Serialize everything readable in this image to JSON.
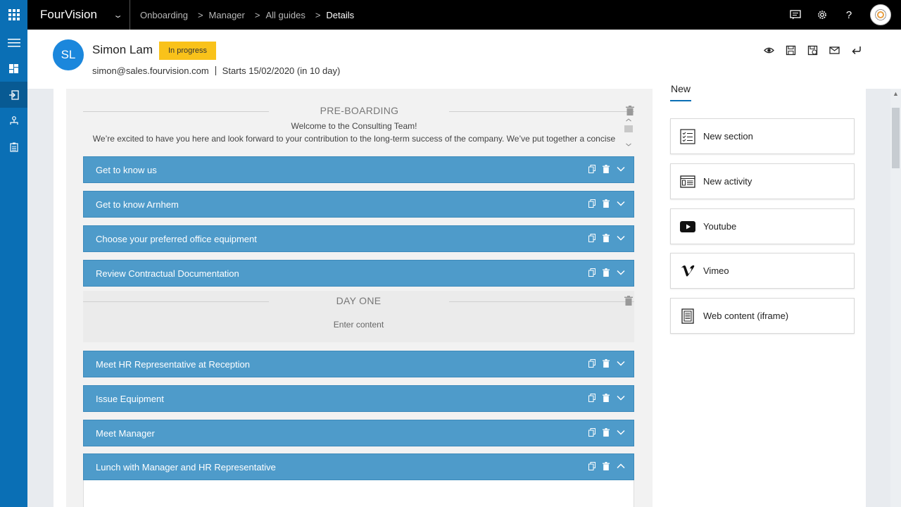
{
  "app": {
    "name": "FourVision"
  },
  "breadcrumb": [
    "Onboarding",
    "Manager",
    "All guides",
    "Details"
  ],
  "employee": {
    "initials": "SL",
    "name": "Simon Lam",
    "status": "In progress",
    "email": "simon@sales.fourvision.com",
    "start": "Starts 15/02/2020 (in 10 day)"
  },
  "sections": [
    {
      "title": "PRE-BOARDING",
      "welcome_line1": "Welcome to the Consulting Team!",
      "welcome_line2": "We’re excited to have you here and look forward to your contribution to the long-term success of the company. We’ve put together a concise",
      "activities": [
        "Get to know us",
        "Get to know Arnhem",
        "Choose your preferred office equipment",
        "Review Contractual Documentation"
      ]
    },
    {
      "title": "DAY ONE",
      "placeholder": "Enter content",
      "activities": [
        "Meet HR Representative at Reception",
        "Issue Equipment",
        "Meet Manager",
        "Lunch with Manager and HR Representative"
      ]
    }
  ],
  "panel": {
    "tab": "New",
    "tiles": [
      {
        "label": "New section",
        "icon": "new-section-icon"
      },
      {
        "label": "New activity",
        "icon": "new-activity-icon"
      },
      {
        "label": "Youtube",
        "icon": "youtube-icon"
      },
      {
        "label": "Vimeo",
        "icon": "vimeo-icon"
      },
      {
        "label": "Web content (iframe)",
        "icon": "web-content-icon"
      }
    ]
  },
  "colors": {
    "brand_blue": "#0a6fb5",
    "activity_blue": "#4e9bca",
    "badge_yellow": "#f9c21a",
    "topbar": "#000000"
  }
}
